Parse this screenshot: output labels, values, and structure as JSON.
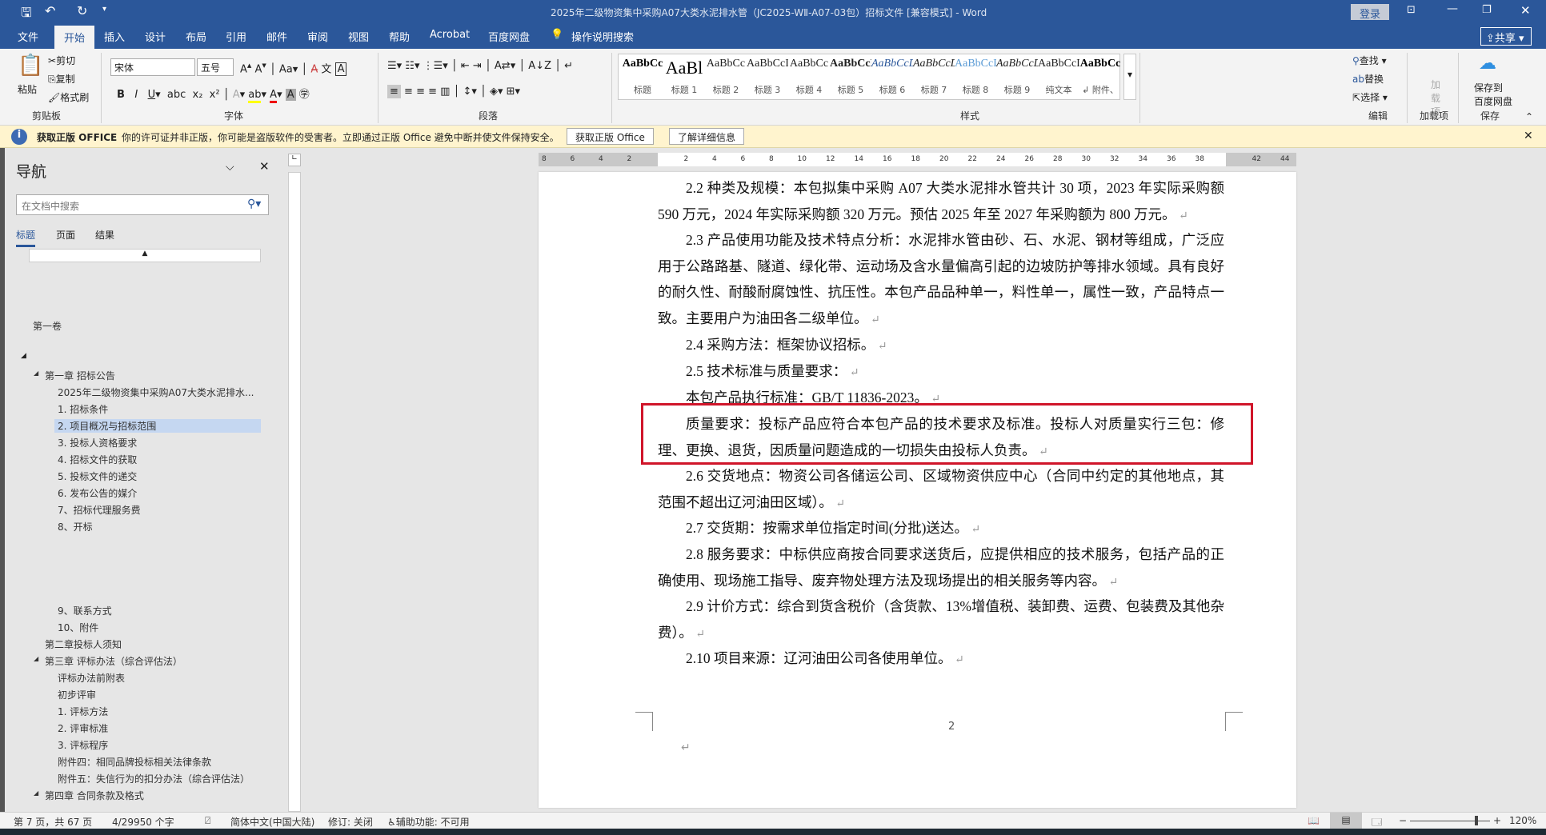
{
  "titlebar": {
    "title": "2025年二级物资集中采购A07大类水泥排水管（JC2025-WⅡ-A07-03包）招标文件 [兼容模式]  -  Word",
    "login": "登录",
    "share": "共享"
  },
  "tabs": [
    "文件",
    "开始",
    "插入",
    "设计",
    "布局",
    "引用",
    "邮件",
    "审阅",
    "视图",
    "帮助",
    "Acrobat",
    "百度网盘"
  ],
  "tell_me": "操作说明搜索",
  "ribbon": {
    "clipboard": {
      "paste": "粘贴",
      "cut": "剪切",
      "copy": "复制",
      "format_painter": "格式刷",
      "label": "剪贴板"
    },
    "font": {
      "name": "宋体",
      "size": "五号",
      "label": "字体"
    },
    "paragraph": {
      "label": "段落"
    },
    "styles": {
      "label": "样式",
      "items": [
        {
          "sample": "AaBbCc",
          "name": "标题"
        },
        {
          "sample": "AaBl",
          "name": "标题 1"
        },
        {
          "sample": "AaBbCc",
          "name": "标题 2"
        },
        {
          "sample": "AaBbCcI",
          "name": "标题 3"
        },
        {
          "sample": "AaBbCc",
          "name": "标题 4"
        },
        {
          "sample": "AaBbCcD",
          "name": "标题 5"
        },
        {
          "sample": "AaBbCcDd",
          "name": "标题 6"
        },
        {
          "sample": "AaBbCcDd",
          "name": "标题 7"
        },
        {
          "sample": "AaBbCcDd",
          "name": "标题 8"
        },
        {
          "sample": "AaBbCcDd",
          "name": "标题 9"
        },
        {
          "sample": "AaBbCcDdI",
          "name": "纯文本"
        },
        {
          "sample": "AaBbCc",
          "name": "↲ 附件、"
        }
      ]
    },
    "editing": {
      "find": "查找",
      "replace": "替换",
      "select": "选择",
      "label": "编辑"
    },
    "addins": {
      "btn": "加载项",
      "label": "加载项"
    },
    "save": {
      "btn1": "保存到",
      "btn2": "百度网盘",
      "label": "保存"
    }
  },
  "msgbar": {
    "title": "获取正版 OFFICE",
    "text": "你的许可证并非正版，你可能是盗版软件的受害者。立即通过正版 Office 避免中断并使文件保持安全。",
    "btn1": "获取正版 Office",
    "btn2": "了解详细信息"
  },
  "nav": {
    "title": "导航",
    "search_placeholder": "在文档中搜索",
    "tabs": [
      "标题",
      "页面",
      "结果"
    ],
    "items": [
      {
        "text": "第一卷",
        "level": 1
      },
      {
        "text": "第一章  招标公告",
        "level": 1
      },
      {
        "text": "2025年二级物资集中采购A07大类水泥排水...",
        "level": 2
      },
      {
        "text": "1. 招标条件",
        "level": 2
      },
      {
        "text": "2. 项目概况与招标范围",
        "level": 2,
        "selected": true
      },
      {
        "text": "3. 投标人资格要求",
        "level": 2
      },
      {
        "text": "4. 招标文件的获取",
        "level": 2
      },
      {
        "text": "5. 投标文件的递交",
        "level": 2
      },
      {
        "text": "6. 发布公告的媒介",
        "level": 2
      },
      {
        "text": "7、招标代理服务费",
        "level": 2
      },
      {
        "text": "8、开标",
        "level": 2
      },
      {
        "text": "9、联系方式",
        "level": 2
      },
      {
        "text": "10、附件",
        "level": 2
      },
      {
        "text": "第二章投标人须知",
        "level": 1
      },
      {
        "text": "第三章  评标办法（综合评估法）",
        "level": 1
      },
      {
        "text": "评标办法前附表",
        "level": 2
      },
      {
        "text": "初步评审",
        "level": 2
      },
      {
        "text": "1. 评标方法",
        "level": 2
      },
      {
        "text": "2. 评审标准",
        "level": 2
      },
      {
        "text": "3. 评标程序",
        "level": 2
      },
      {
        "text": "附件四：相同品牌投标相关法律条款",
        "level": 2
      },
      {
        "text": "附件五：失信行为的扣分办法（综合评估法）",
        "level": 2
      },
      {
        "text": "第四章  合同条款及格式",
        "level": 1
      }
    ]
  },
  "ruler": [
    "8",
    "6",
    "4",
    "2",
    "",
    "2",
    "4",
    "6",
    "8",
    "10",
    "12",
    "14",
    "16",
    "18",
    "20",
    "22",
    "24",
    "26",
    "28",
    "30",
    "32",
    "34",
    "36",
    "38",
    "",
    "42",
    "44"
  ],
  "document": {
    "paragraphs": [
      {
        "text": "2.2 种类及规模：本包拟集中采购 A07 大类水泥排水管共计 30 项，2023 年实际采购额 590 万元，2024 年实际采购额 320 万元。预估 2025 年至 2027 年采购额为 800 万元。",
        "indent": true
      },
      {
        "text": "2.3 产品使用功能及技术特点分析：水泥排水管由砂、石、水泥、钢材等组成，广泛应用于公路路基、隧道、绿化带、运动场及含水量偏高引起的边坡防护等排水领域。具有良好的耐久性、耐酸耐腐蚀性、抗压性。本包产品品种单一，料性单一，属性一致，产品特点一致。主要用户为油田各二级单位。",
        "indent": true
      },
      {
        "text": "2.4 采购方法：框架协议招标。",
        "indent": true
      },
      {
        "text": "2.5 技术标准与质量要求：",
        "indent": true
      },
      {
        "text": "本包产品执行标准：GB/T 11836-2023。",
        "indent": true
      },
      {
        "text": "质量要求：投标产品应符合本包产品的技术要求及标准。投标人对质量实行三包：修理、更换、退货，因质量问题造成的一切损失由投标人负责。",
        "indent": true
      },
      {
        "text": "2.6 交货地点：物资公司各储运公司、区域物资供应中心（合同中约定的其他地点，其范围不超出辽河油田区域）。",
        "indent": true
      },
      {
        "text": "2.7 交货期：按需求单位指定时间(分批)送达。",
        "indent": true
      },
      {
        "text": "2.8 服务要求：中标供应商按合同要求送货后，应提供相应的技术服务，包括产品的正确使用、现场施工指导、废弃物处理方法及现场提出的相关服务等内容。",
        "indent": true
      },
      {
        "text": "2.9 计价方式：综合到货含税价（含货款、13%增值税、装卸费、运费、包装费及其他杂费）。",
        "indent": true
      },
      {
        "text": "2.10 项目来源：辽河油田公司各使用单位。",
        "indent": true
      }
    ],
    "page_number": "2",
    "highlight_color": "#d0152a"
  },
  "status": {
    "page": "第 7 页，共 67 页",
    "words": "4/29950 个字",
    "language": "简体中文(中国大陆)",
    "track": "修订: 关闭",
    "accessibility": "辅助功能: 不可用",
    "zoom": "120%",
    "zoom_percent": 120
  },
  "colors": {
    "accent": "#2b579a",
    "msgbar": "#fff4ce",
    "selected_nav": "#c5d7f1"
  }
}
